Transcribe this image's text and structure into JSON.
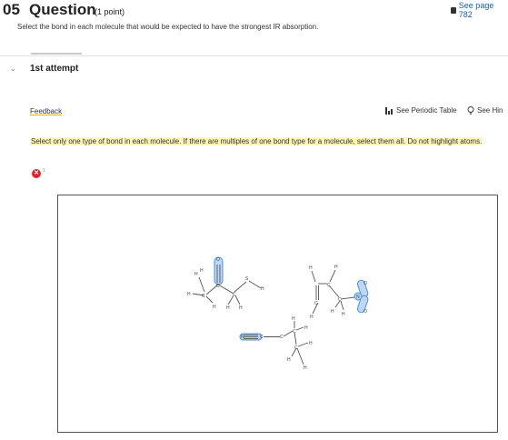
{
  "question": {
    "number": "05",
    "title": "Question",
    "points": "(1 point)",
    "see_page": "See page 782",
    "prompt": "Select the bond in each molecule that would be expected to have the strongest IR absorption."
  },
  "attempt": {
    "label": "1st attempt"
  },
  "toolbar": {
    "feedback": "Feedback",
    "periodic_table": "See Periodic Table",
    "hint": "See Hin"
  },
  "feedback": {
    "message": "Select only one type of bond in each molecule. If there are multiples of one bond type for a molecule, select them all. Do not highlight atoms.",
    "status": "incorrect",
    "error_count": "1"
  },
  "molecules": {
    "thioester": {
      "atoms": [
        "O",
        "C",
        "C",
        "S",
        "H",
        "H",
        "H",
        "H",
        "H",
        "H",
        "H",
        "H"
      ]
    },
    "alkene_nitro": {
      "atoms": [
        "H",
        "H",
        "C",
        "C",
        "C",
        "N",
        "O",
        "O",
        "H",
        "H",
        "H"
      ]
    },
    "nitrile": {
      "atoms": [
        "N",
        "C",
        "C",
        "C",
        "H",
        "H",
        "H",
        "H",
        "H"
      ]
    }
  },
  "colors": {
    "accent": "#1a5fa8",
    "highlight": "#4a8fd6",
    "highlight_fill": "#bcd6f4",
    "error": "#d9262c",
    "message_bg": "#fff5b8"
  }
}
